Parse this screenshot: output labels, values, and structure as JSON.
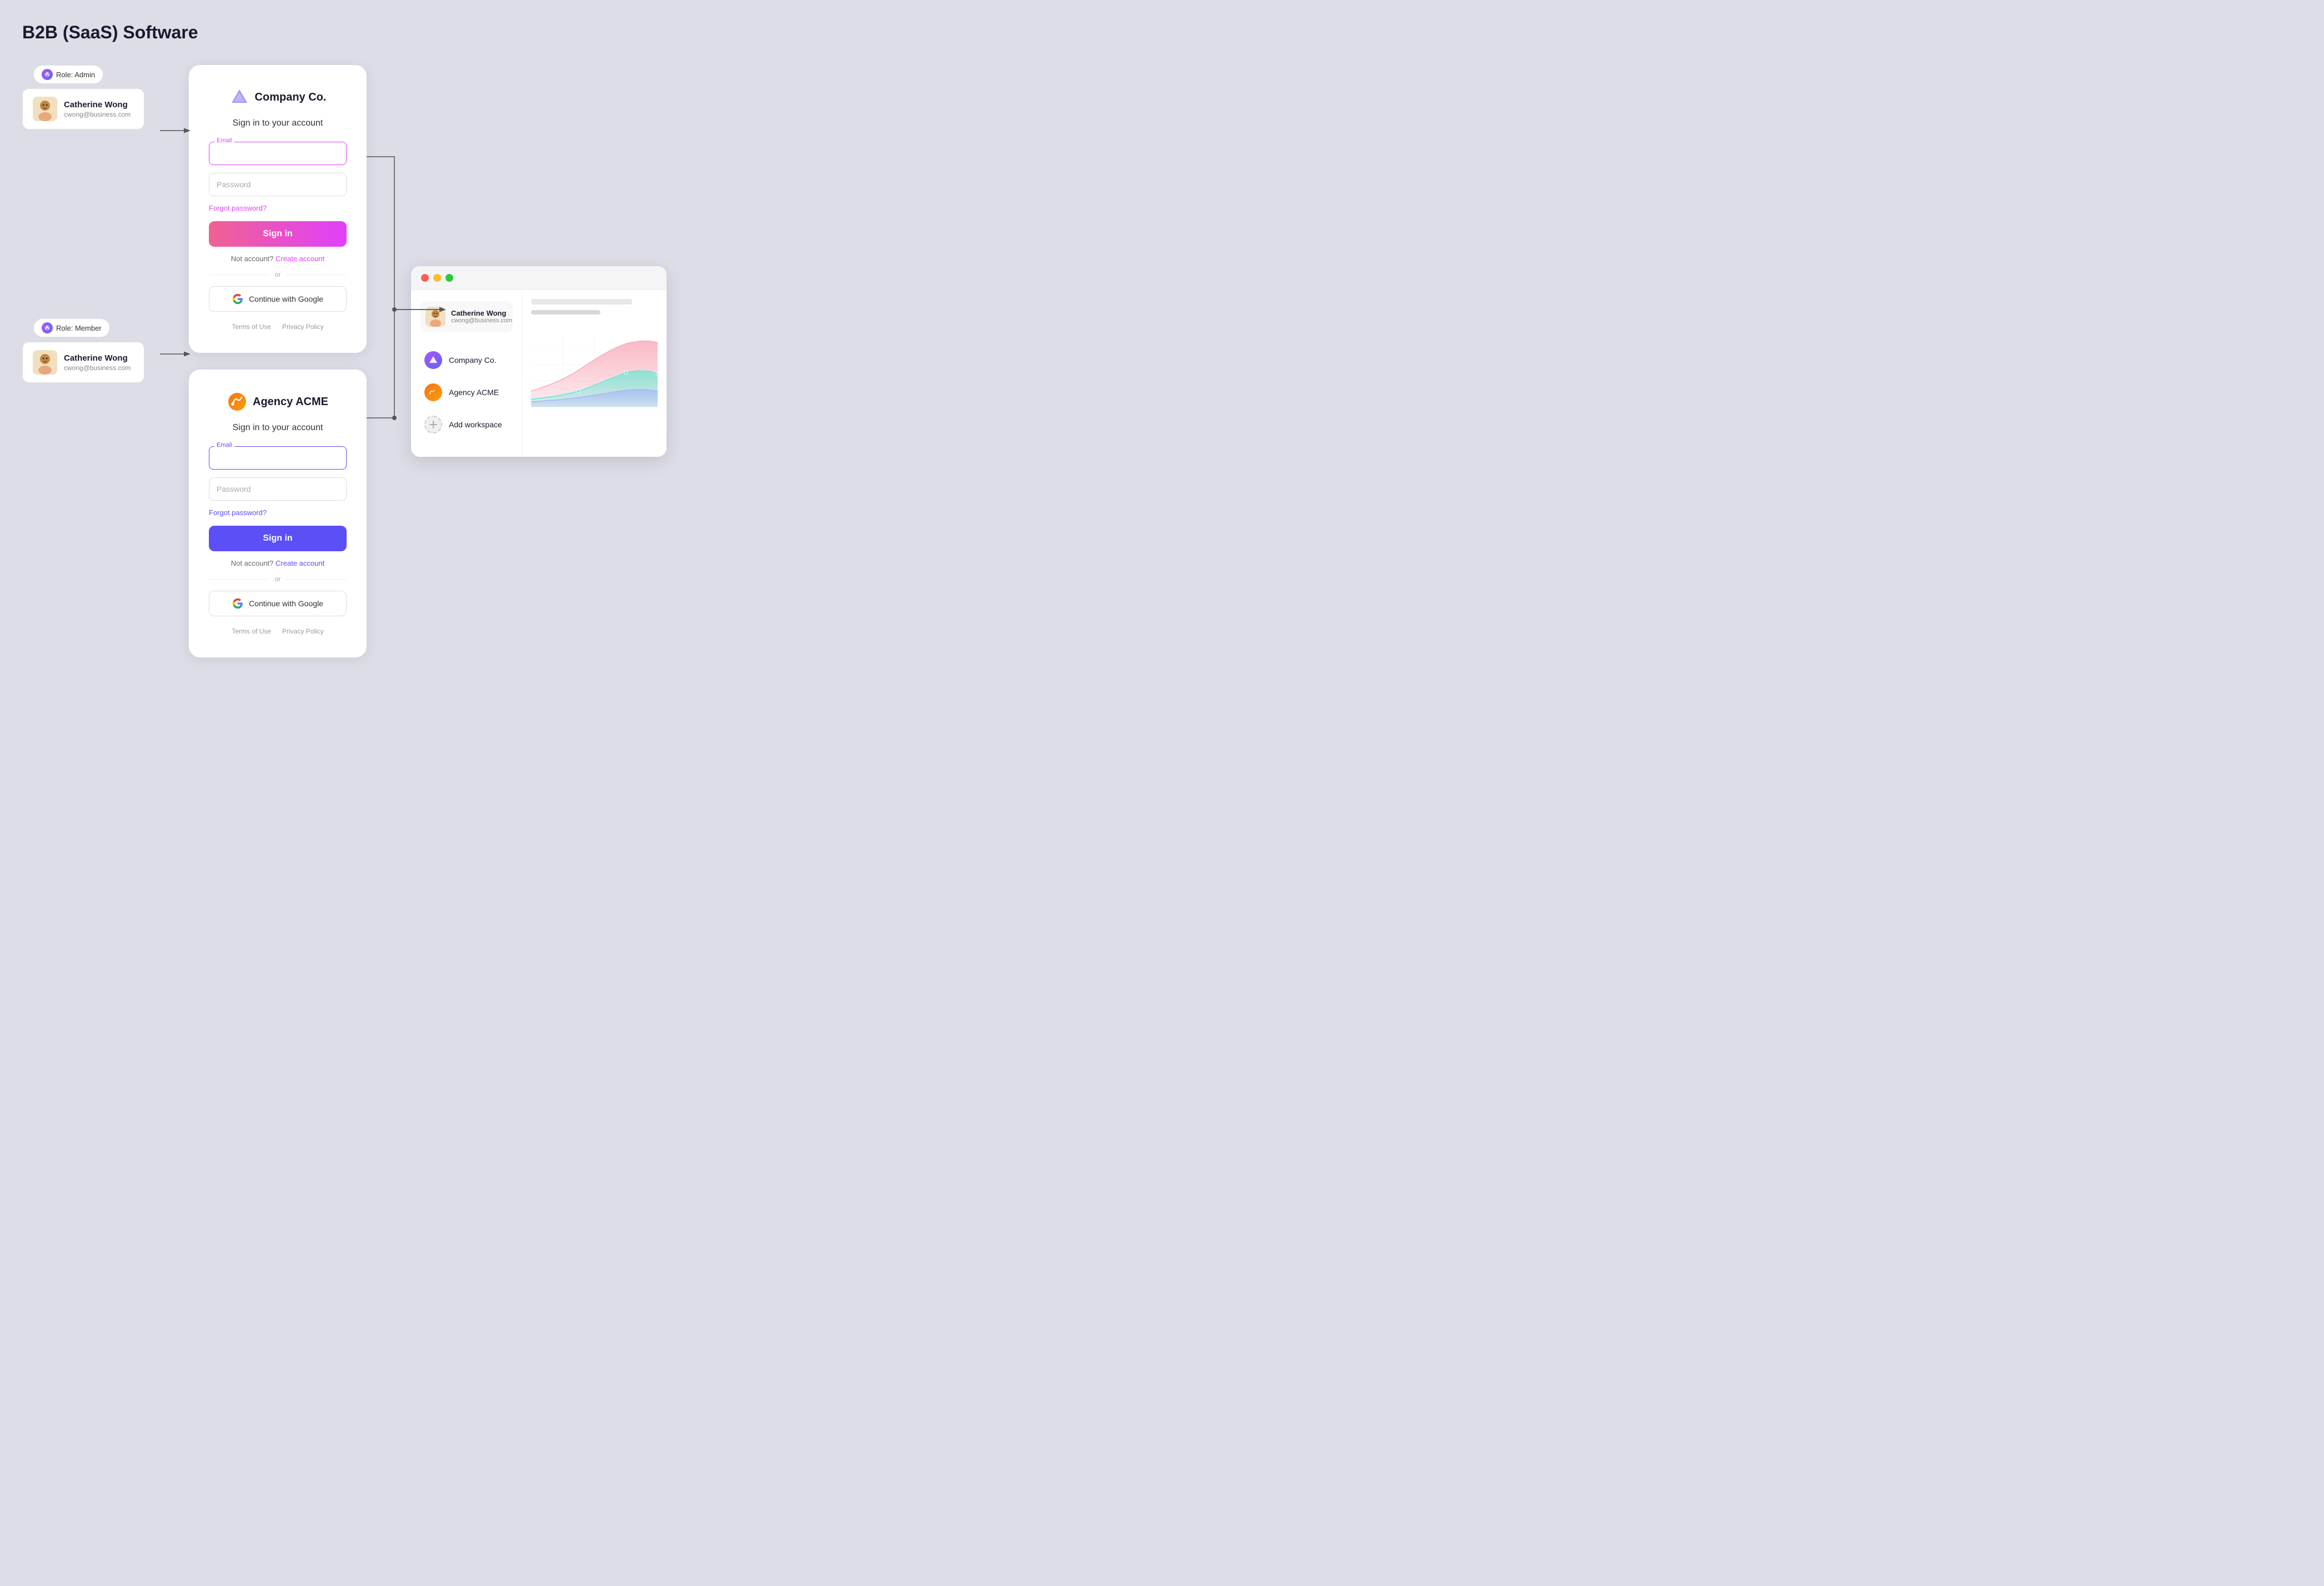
{
  "page": {
    "title": "B2B (SaaS) Software"
  },
  "users": {
    "admin": {
      "name": "Catherine Wong",
      "email": "cwong@business.com",
      "role": "Role: Admin"
    },
    "member": {
      "name": "Catherine Wong",
      "email": "cwong@business.com",
      "role": "Role: Member"
    }
  },
  "company_login": {
    "logo_name": "Company Co.",
    "title": "Sign in to your account",
    "email_label": "Email",
    "email_placeholder": "",
    "password_placeholder": "Password",
    "forgot_password": "Forgot password?",
    "sign_in_label": "Sign in",
    "no_account_text": "Not account?",
    "create_account": "Create account",
    "or_text": "or",
    "google_button": "Continue with Google",
    "terms": "Terms of Use",
    "privacy": "Privacy Policy"
  },
  "agency_login": {
    "logo_name": "Agency ACME",
    "title": "Sign in to your account",
    "email_label": "Email",
    "email_placeholder": "",
    "password_placeholder": "Password",
    "forgot_password": "Forgot password?",
    "sign_in_label": "Sign in",
    "no_account_text": "Not account?",
    "create_account": "Create account",
    "or_text": "or",
    "google_button": "Continue with Google",
    "terms": "Terms of Use",
    "privacy": "Privacy Policy"
  },
  "workspace": {
    "user_name": "Catherine Wong",
    "user_email": "cwong@business.com",
    "items": [
      {
        "name": "Company Co.",
        "type": "company"
      },
      {
        "name": "Agency ACME",
        "type": "agency"
      },
      {
        "name": "Add workspace",
        "type": "add"
      }
    ]
  }
}
